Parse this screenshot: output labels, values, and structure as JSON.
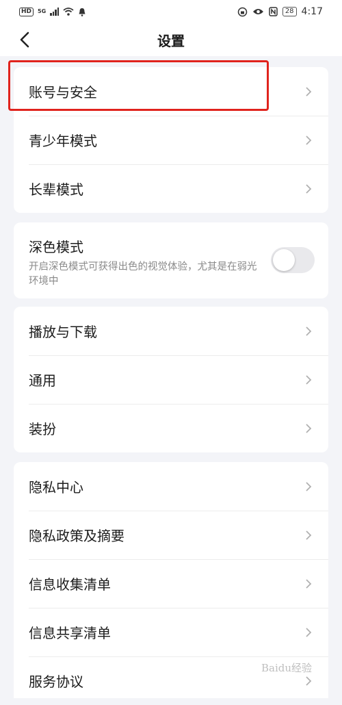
{
  "status_bar": {
    "left_badge": "HD",
    "network": "5G",
    "battery": "28",
    "time": "4:17"
  },
  "header": {
    "title": "设置",
    "back_icon": "chevron-left-icon"
  },
  "groups": {
    "account": [
      {
        "label": "账号与安全",
        "highlighted": true
      },
      {
        "label": "青少年模式"
      },
      {
        "label": "长辈模式"
      }
    ],
    "dark_mode": {
      "title": "深色模式",
      "description": "开启深色模式可获得出色的视觉体验，尤其是在弱光环境中",
      "enabled": false
    },
    "general": [
      {
        "label": "播放与下载"
      },
      {
        "label": "通用"
      },
      {
        "label": "装扮"
      }
    ],
    "privacy": [
      {
        "label": "隐私中心"
      },
      {
        "label": "隐私政策及摘要"
      },
      {
        "label": "信息收集清单"
      },
      {
        "label": "信息共享清单"
      },
      {
        "label": "服务协议"
      }
    ]
  },
  "colors": {
    "highlight": "#e0231d",
    "background": "#f3f4f8",
    "chevron": "#b0b0b0"
  },
  "watermark": "Baidu经验"
}
